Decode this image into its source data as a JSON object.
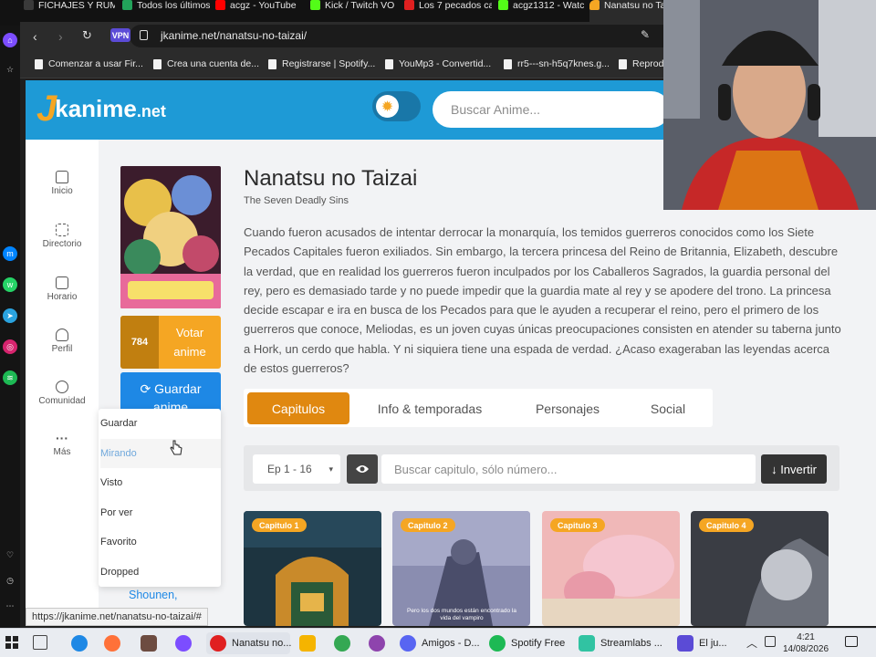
{
  "browser": {
    "tabs": [
      {
        "label": "FICHAJES Y RUM",
        "color": "#3a3a3a"
      },
      {
        "label": "Todos los últimos",
        "color": "#22a35a"
      },
      {
        "label": "acgz - YouTube",
        "color": "#ff0000"
      },
      {
        "label": "Kick / Twitch VO",
        "color": "#53fc18"
      },
      {
        "label": "Los 7 pecados ca",
        "color": "#e02020"
      },
      {
        "label": "acgz1312 - Watc",
        "color": "#53fc18"
      },
      {
        "label": "Nanatsu no Ta",
        "color": "#f5a623"
      }
    ],
    "vpn_label": "VPN",
    "url": "jkanime.net/nanatsu-no-taizai/",
    "bookmarks": [
      "Comenzar a usar Fir...",
      "Crea una cuenta de...",
      "Registrarse | Spotify...",
      "YouMp3 - Convertid...",
      "rr5---sn-h5q7knes.g...",
      "Reprodu"
    ]
  },
  "site": {
    "logo_k": "J",
    "logo_text": "kanime",
    "logo_tld": ".net",
    "search_placeholder": "Buscar Anime..."
  },
  "nav": [
    {
      "label": "Inicio",
      "icon": "home-icon"
    },
    {
      "label": "Directorio",
      "icon": "list-icon"
    },
    {
      "label": "Horario",
      "icon": "calendar-icon"
    },
    {
      "label": "Perfil",
      "icon": "user-icon"
    },
    {
      "label": "Comunidad",
      "icon": "users-icon"
    },
    {
      "label": "Más",
      "icon": "more-icon"
    }
  ],
  "anime": {
    "title": "Nanatsu no Taizai",
    "subtitle": "The Seven Deadly Sins",
    "synopsis": "Cuando fueron acusados de intentar derrocar la monarquía, los temidos guerreros conocidos como los Siete Pecados Capitales fueron exiliados. Sin embargo, la tercera princesa del Reino de Britannia, Elizabeth, descubre la verdad, que en realidad los guerreros fueron inculpados por los Caballeros Sagrados, la guardia personal del rey, pero es demasiado tarde y no puede impedir que la guardia mate al rey y se apodere del trono. La princesa decide escapar e ira en busca de los Pecados para que le ayuden a recuperar el reino, pero el primero de los guerreros que conoce, Meliodas, es un joven cuyas únicas preocupaciones consisten en atender su taberna junto a Hork, un cerdo que habla. Y ni siquiera tiene una espada de verdad. ¿Acaso exageraban las leyendas acerca de estos guerreros?",
    "votes": "784",
    "vote_label_1": "Votar",
    "vote_label_2": "anime",
    "save_label_1": "Guardar",
    "save_label_2": "anime",
    "genre_link": "Shounen,"
  },
  "save_menu": [
    "Guardar",
    "Mirando",
    "Visto",
    "Por ver",
    "Favorito",
    "Dropped"
  ],
  "tabs": [
    "Capitulos",
    "Info & temporadas",
    "Personajes",
    "Social"
  ],
  "episodes_toolbar": {
    "range": "Ep 1 - 16",
    "search_placeholder": "Buscar capitulo, sólo número...",
    "invert_label": "↓ Invertir"
  },
  "episodes": [
    {
      "badge": "Capitulo 1"
    },
    {
      "badge": "Capitulo 2",
      "subtitle": "Pero los dos mundos están encontrado la vida del vampiro"
    },
    {
      "badge": "Capitulo 3"
    },
    {
      "badge": "Capitulo 4"
    }
  ],
  "status_url": "https://jkanime.net/nanatsu-no-taizai/#",
  "taskbar": {
    "apps": [
      {
        "label": "Nanatsu no...",
        "color": "#e02020"
      },
      {
        "label": "Amigos - D...",
        "color": "#5865f2"
      },
      {
        "label": "Spotify Free",
        "color": "#1db954"
      },
      {
        "label": "Streamlabs ...",
        "color": "#31c3a2"
      },
      {
        "label": "El ju...",
        "color": "#5b4bd6"
      }
    ],
    "time": "4:21",
    "date": "14/08/2026"
  },
  "colors": {
    "brand": "#1e9ad6",
    "accent": "#f5a623",
    "tab_active": "#e08810"
  }
}
